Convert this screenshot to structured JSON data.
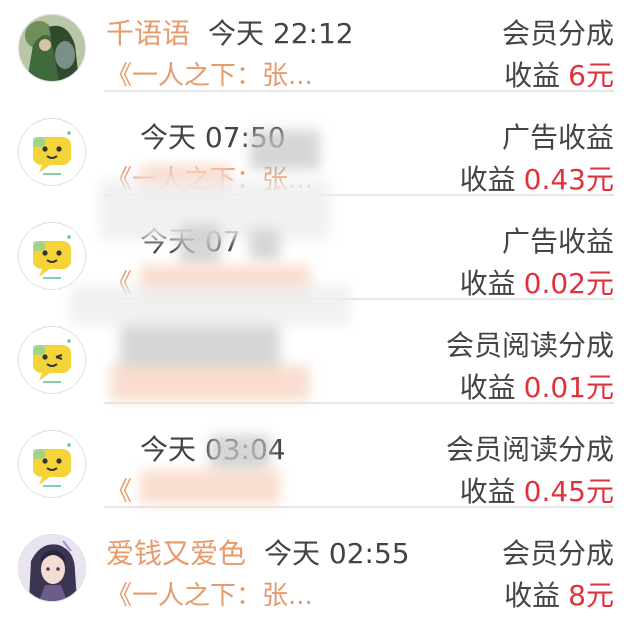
{
  "rows": [
    {
      "nickname": "千语语",
      "time": "今天 22:12",
      "title": "《一人之下：张...",
      "type": "会员分成",
      "earn_label": "收益",
      "amount": "6元",
      "avatar": "anime-avatar-green"
    },
    {
      "nickname": "",
      "time": "今天 07:50",
      "title": "《一人之下：张...",
      "type": "广告收益",
      "earn_label": "收益",
      "amount": "0.43元",
      "avatar": "chat-bubble-avatar"
    },
    {
      "nickname": "",
      "time": "今天 07",
      "title": "《",
      "type": "广告收益",
      "earn_label": "收益",
      "amount": "0.02元",
      "avatar": "chat-bubble-avatar"
    },
    {
      "nickname": "",
      "time": "",
      "title": "",
      "type": "会员阅读分成",
      "earn_label": "收益",
      "amount": "0.01元",
      "avatar": "chat-bubble-avatar"
    },
    {
      "nickname": "",
      "time": "今天 03:04",
      "title": "《",
      "type": "会员阅读分成",
      "earn_label": "收益",
      "amount": "0.45元",
      "avatar": "chat-bubble-avatar"
    },
    {
      "nickname": "爱钱又爱色",
      "time": "今天 02:55",
      "title": "《一人之下：张...",
      "type": "会员分成",
      "earn_label": "收益",
      "amount": "8元",
      "avatar": "anime-avatar-portrait"
    }
  ],
  "colors": {
    "nickname": "#e79a6a",
    "amount": "#e0323b",
    "text": "#444444",
    "divider": "#e6e6e6"
  }
}
